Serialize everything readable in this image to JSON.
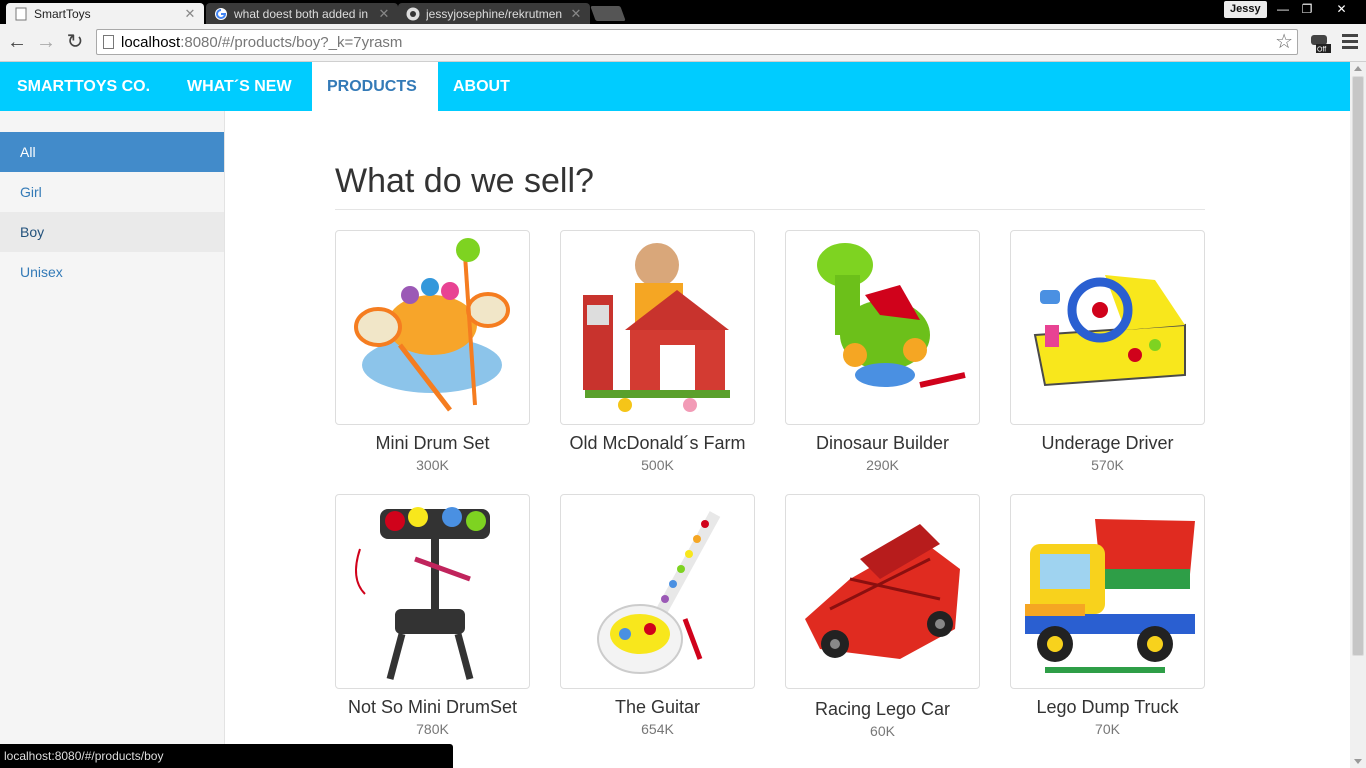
{
  "browser": {
    "tabs": [
      {
        "title": "SmartToys",
        "icon": "page-icon",
        "active": true
      },
      {
        "title": "what doest both added in",
        "icon": "google-icon",
        "active": false
      },
      {
        "title": "jessyjosephine/rekrutmen",
        "icon": "github-icon",
        "active": false
      }
    ],
    "profile_name": "Jessy",
    "url_host": "localhost",
    "url_rest": ":8080/#/products/boy?_k=7yrasm",
    "status_url": "localhost:8080/#/products/boy"
  },
  "navbar": {
    "brand": "SMARTTOYS CO.",
    "items": [
      {
        "label": "WHAT´S NEW",
        "active": false
      },
      {
        "label": "PRODUCTS",
        "active": true
      },
      {
        "label": "ABOUT",
        "active": false
      }
    ],
    "color": "#00ccff"
  },
  "sidebar": {
    "items": [
      {
        "label": "All",
        "state": "active"
      },
      {
        "label": "Girl",
        "state": "normal"
      },
      {
        "label": "Boy",
        "state": "hover"
      },
      {
        "label": "Unisex",
        "state": "normal"
      }
    ]
  },
  "main": {
    "heading": "What do we sell?",
    "products": [
      {
        "name": "Mini Drum Set",
        "price": "300K",
        "image": "drum-set-image"
      },
      {
        "name": "Old McDonald´s Farm",
        "price": "500K",
        "image": "farm-image"
      },
      {
        "name": "Dinosaur Builder",
        "price": "290K",
        "image": "dinosaur-image"
      },
      {
        "name": "Underage Driver",
        "price": "570K",
        "image": "driver-toy-image"
      },
      {
        "name": "Not So Mini DrumSet",
        "price": "780K",
        "image": "electronic-drum-image"
      },
      {
        "name": "The Guitar",
        "price": "654K",
        "image": "guitar-image"
      },
      {
        "name": "Racing Lego Car",
        "price": "60K",
        "image": "lego-car-image"
      },
      {
        "name": "Lego Dump Truck",
        "price": "70K",
        "image": "dump-truck-image"
      }
    ]
  }
}
